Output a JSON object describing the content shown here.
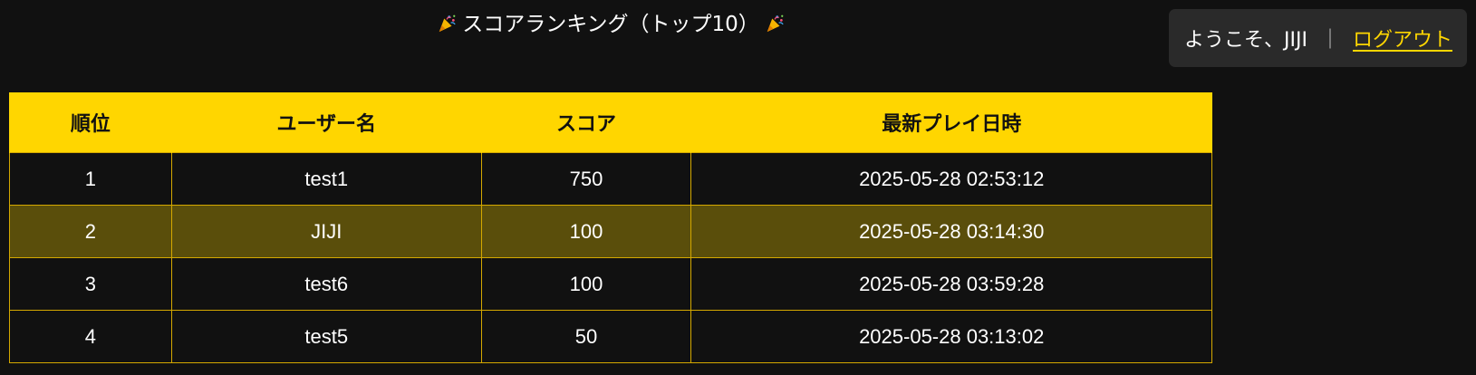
{
  "title": {
    "text": "スコアランキング（トップ10）",
    "icon": "party-popper-icon"
  },
  "user_box": {
    "welcome": "ようこそ、JIJI",
    "separator": "｜",
    "logout_label": "ログアウト"
  },
  "table": {
    "headers": [
      "順位",
      "ユーザー名",
      "スコア",
      "最新プレイ日時"
    ],
    "rows": [
      {
        "rank": "1",
        "user": "test1",
        "score": "750",
        "date": "2025-05-28 02:53:12",
        "highlight": false
      },
      {
        "rank": "2",
        "user": "JIJI",
        "score": "100",
        "date": "2025-05-28 03:14:30",
        "highlight": true
      },
      {
        "rank": "3",
        "user": "test6",
        "score": "100",
        "date": "2025-05-28 03:59:28",
        "highlight": false
      },
      {
        "rank": "4",
        "user": "test5",
        "score": "50",
        "date": "2025-05-28 03:13:02",
        "highlight": false
      }
    ]
  },
  "colors": {
    "background": "#111111",
    "accent": "#ffd600",
    "highlight_row": "#5a4e0b",
    "user_box": "#2a2a2a"
  }
}
